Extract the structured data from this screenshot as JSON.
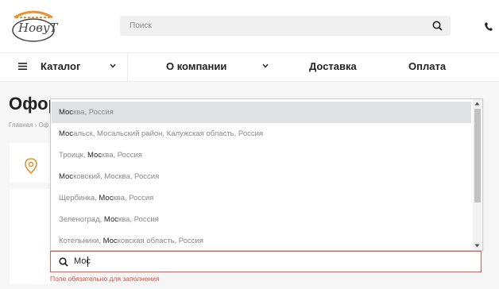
{
  "logo": {
    "text": "НовуТ"
  },
  "search": {
    "placeholder": "Поиск"
  },
  "nav": {
    "catalog": "Каталог",
    "about": "О компании",
    "delivery": "Доставка",
    "payment": "Оплата"
  },
  "page": {
    "title": "Офор",
    "breadcrumb": "Главная › Оф"
  },
  "suggestions": [
    {
      "match": "Мос",
      "rest": "ква, Россия",
      "prefix": ""
    },
    {
      "match": "Мос",
      "rest": "альск, Мосальский район, Калужская область, Россия",
      "prefix": ""
    },
    {
      "prefix": "Троицк, ",
      "match": "Мос",
      "rest": "ква, Россия"
    },
    {
      "match": "Мос",
      "rest": "ковский, Москва, Россия",
      "prefix": ""
    },
    {
      "prefix": "Щербинка, ",
      "match": "Мос",
      "rest": "ква, Россия"
    },
    {
      "prefix": "Зеленоград, ",
      "match": "Мос",
      "rest": "ква, Россия"
    },
    {
      "prefix": "Котельники, ",
      "match": "Мос",
      "rest": "ковская область, Россия"
    }
  ],
  "city_input": {
    "value": "Мос"
  },
  "error": "Поле обязательно для заполнения",
  "colors": {
    "accent": "#e8922f",
    "error": "#e04b3f",
    "active_row": "#dfe2e5"
  }
}
